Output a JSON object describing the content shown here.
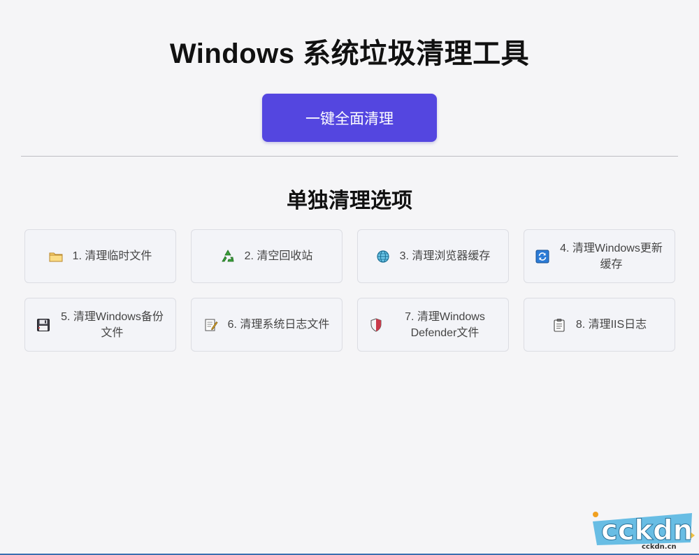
{
  "header": {
    "title": "Windows 系统垃圾清理工具"
  },
  "main_action": {
    "label": "一键全面清理"
  },
  "section": {
    "title": "单独清理选项"
  },
  "options": [
    {
      "label": "1. 清理临时文件",
      "icon": "folder-icon"
    },
    {
      "label": "2. 清空回收站",
      "icon": "recycle-icon"
    },
    {
      "label": "3. 清理浏览器缓存",
      "icon": "globe-icon"
    },
    {
      "label": "4. 清理Windows更新缓存",
      "icon": "refresh-icon"
    },
    {
      "label": "5. 清理Windows备份文件",
      "icon": "floppy-disk-icon"
    },
    {
      "label": "6. 清理系统日志文件",
      "icon": "memo-icon"
    },
    {
      "label": "7. 清理Windows Defender文件",
      "icon": "shield-icon"
    },
    {
      "label": "8. 清理IIS日志",
      "icon": "clipboard-icon"
    }
  ],
  "watermark": {
    "logo_text": "ckdn",
    "domain_text": "cckdn.cn"
  },
  "colors": {
    "accent": "#5446e0",
    "background": "#f5f5f7",
    "card": "#f3f4f8"
  }
}
